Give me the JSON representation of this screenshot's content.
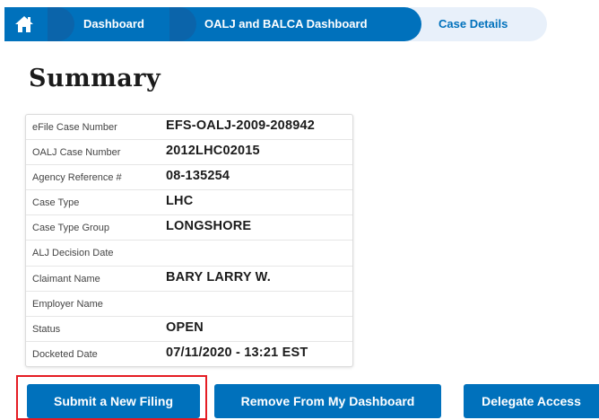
{
  "breadcrumb": {
    "home_icon": "home-icon",
    "items": [
      {
        "label": "Dashboard"
      },
      {
        "label": "OALJ and BALCA Dashboard"
      },
      {
        "label": "Case Details"
      }
    ]
  },
  "page_title": "Summary",
  "summary": {
    "rows": [
      {
        "label": "eFile Case Number",
        "value": "EFS-OALJ-2009-208942"
      },
      {
        "label": "OALJ Case Number",
        "value": "2012LHC02015"
      },
      {
        "label": "Agency Reference #",
        "value": "08-135254"
      },
      {
        "label": "Case Type",
        "value": "LHC"
      },
      {
        "label": "Case Type Group",
        "value": "LONGSHORE"
      },
      {
        "label": "ALJ Decision Date",
        "value": ""
      },
      {
        "label": "Claimant Name",
        "value": "BARY LARRY W."
      },
      {
        "label": "Employer Name",
        "value": ""
      },
      {
        "label": "Status",
        "value": "OPEN"
      },
      {
        "label": "Docketed Date",
        "value": "07/11/2020 - 13:21 EST"
      }
    ]
  },
  "actions": {
    "submit_label": "Submit a New Filing",
    "remove_label": "Remove From My Dashboard",
    "delegate_label": "Delegate Access"
  },
  "colors": {
    "primary": "#0071bc",
    "crumb_light": "#e8f0fa",
    "highlight": "#e51c23"
  }
}
